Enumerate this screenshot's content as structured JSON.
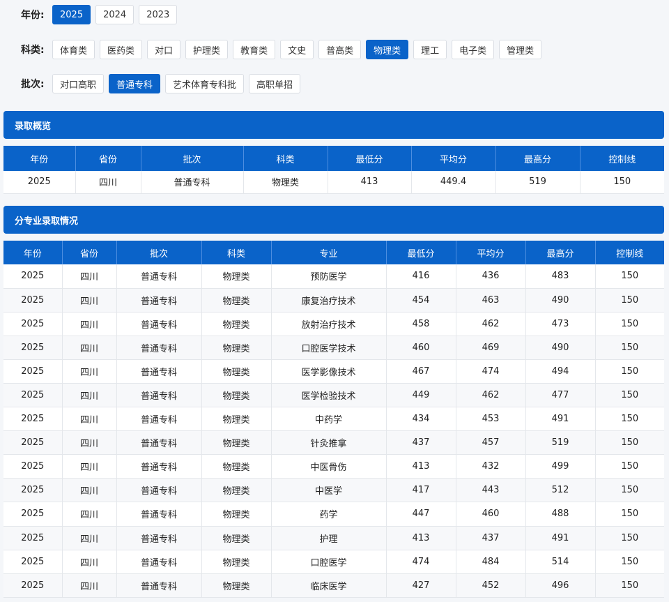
{
  "filters": {
    "year": {
      "label": "年份:",
      "options": [
        "2025",
        "2024",
        "2023"
      ],
      "active": 0
    },
    "category": {
      "label": "科类:",
      "options": [
        "体育类",
        "医药类",
        "对口",
        "护理类",
        "教育类",
        "文史",
        "普高类",
        "物理类",
        "理工",
        "电子类",
        "管理类"
      ],
      "active": 7
    },
    "batch": {
      "label": "批次:",
      "options": [
        "对口高职",
        "普通专科",
        "艺术体育专科批",
        "高职单招"
      ],
      "active": 1
    }
  },
  "overview": {
    "title": "录取概览",
    "headers": [
      "年份",
      "省份",
      "批次",
      "科类",
      "最低分",
      "平均分",
      "最高分",
      "控制线"
    ],
    "row": [
      "2025",
      "四川",
      "普通专科",
      "物理类",
      "413",
      "449.4",
      "519",
      "150"
    ]
  },
  "majors": {
    "title": "分专业录取情况",
    "headers": [
      "年份",
      "省份",
      "批次",
      "科类",
      "专业",
      "最低分",
      "平均分",
      "最高分",
      "控制线"
    ],
    "rows": [
      [
        "2025",
        "四川",
        "普通专科",
        "物理类",
        "预防医学",
        "416",
        "436",
        "483",
        "150"
      ],
      [
        "2025",
        "四川",
        "普通专科",
        "物理类",
        "康复治疗技术",
        "454",
        "463",
        "490",
        "150"
      ],
      [
        "2025",
        "四川",
        "普通专科",
        "物理类",
        "放射治疗技术",
        "458",
        "462",
        "473",
        "150"
      ],
      [
        "2025",
        "四川",
        "普通专科",
        "物理类",
        "口腔医学技术",
        "460",
        "469",
        "490",
        "150"
      ],
      [
        "2025",
        "四川",
        "普通专科",
        "物理类",
        "医学影像技术",
        "467",
        "474",
        "494",
        "150"
      ],
      [
        "2025",
        "四川",
        "普通专科",
        "物理类",
        "医学检验技术",
        "449",
        "462",
        "477",
        "150"
      ],
      [
        "2025",
        "四川",
        "普通专科",
        "物理类",
        "中药学",
        "434",
        "453",
        "491",
        "150"
      ],
      [
        "2025",
        "四川",
        "普通专科",
        "物理类",
        "针灸推拿",
        "437",
        "457",
        "519",
        "150"
      ],
      [
        "2025",
        "四川",
        "普通专科",
        "物理类",
        "中医骨伤",
        "413",
        "432",
        "499",
        "150"
      ],
      [
        "2025",
        "四川",
        "普通专科",
        "物理类",
        "中医学",
        "417",
        "443",
        "512",
        "150"
      ],
      [
        "2025",
        "四川",
        "普通专科",
        "物理类",
        "药学",
        "447",
        "460",
        "488",
        "150"
      ],
      [
        "2025",
        "四川",
        "普通专科",
        "物理类",
        "护理",
        "413",
        "437",
        "491",
        "150"
      ],
      [
        "2025",
        "四川",
        "普通专科",
        "物理类",
        "口腔医学",
        "474",
        "484",
        "514",
        "150"
      ],
      [
        "2025",
        "四川",
        "普通专科",
        "物理类",
        "临床医学",
        "427",
        "452",
        "496",
        "150"
      ]
    ]
  }
}
